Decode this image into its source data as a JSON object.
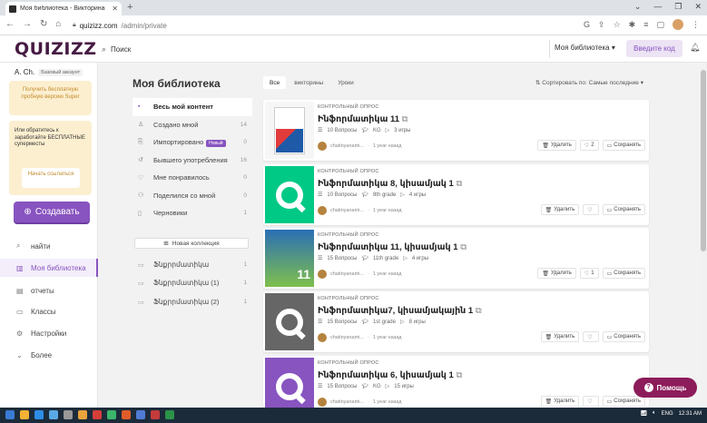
{
  "browser": {
    "tab_title": "Моя библиотека - Викторина",
    "url_host": "quizizz.com",
    "url_path": "/admin/private"
  },
  "header": {
    "logo": "QUIZIZZ",
    "search_placeholder": "Поиск",
    "library_selector": "Моя библиотека",
    "enter_code": "Введите код"
  },
  "sidebar": {
    "user_name": "A. Ch.",
    "account_type": "Базовый аккаунт",
    "promo_text": "Получить бесплатную пробную версию Super",
    "promo2_text": "Или обратитесь к заработайте БЕСПЛАТНЫЕ суперместы",
    "promo2_button": "Начать ссылаться",
    "create_button": "Создавать",
    "items": [
      {
        "label": "найти",
        "icon": "search-icon"
      },
      {
        "label": "Моя библиотека",
        "icon": "library-icon",
        "active": true
      },
      {
        "label": "отчеты",
        "icon": "reports-icon"
      },
      {
        "label": "Классы",
        "icon": "classes-icon"
      },
      {
        "label": "Настройки",
        "icon": "settings-icon"
      },
      {
        "label": "Более",
        "icon": "chevron-down-icon"
      }
    ]
  },
  "main": {
    "title": "Моя библиотека",
    "library_nav": [
      {
        "label": "Весь мой контент",
        "count": ""
      },
      {
        "label": "Создано мной",
        "count": "14"
      },
      {
        "label": "Импортировано",
        "badge": "Новый",
        "count": "0"
      },
      {
        "label": "Бывшего употребления",
        "count": "16"
      },
      {
        "label": "Мне понравилось",
        "count": "0"
      },
      {
        "label": "Поделился со мной",
        "count": "0"
      },
      {
        "label": "Черновики",
        "count": "1"
      }
    ],
    "new_collection": "Новая коллекция",
    "collections": [
      {
        "label": "Ֆնքրրմատիկա",
        "count": "1"
      },
      {
        "label": "Ֆնքրրմատիկա (1)",
        "count": "1"
      },
      {
        "label": "Ֆնքրրմատիկա (2)",
        "count": "1"
      }
    ],
    "filters": [
      "Все",
      "викторины",
      "Уроки"
    ],
    "sort_label": "Сортировать по: Самые последние"
  },
  "cards": [
    {
      "type": "КОНТРОЛЬНЫЙ ОПРОС",
      "name": "Ինֆորմատիկա 11",
      "questions": "10 Вопросы",
      "grade": "KG",
      "plays": "3 игры",
      "author": "chatinyanami...",
      "time": "1 year назад",
      "delete": "Удалить",
      "likes": "2",
      "save": "Сохранять",
      "thumb": "book"
    },
    {
      "type": "КОНТРОЛЬНЫЙ ОПРОС",
      "name": "Ինֆորմատիկա 8, կիսամյակ 1",
      "questions": "10 Вопросы",
      "grade": "8th grade",
      "plays": "4 игры",
      "author": "chatinyanami...",
      "time": "1 year назад",
      "delete": "Удалить",
      "likes": "",
      "save": "Сохранять",
      "thumb": "green"
    },
    {
      "type": "КОНТРОЛЬНЫЙ ОПРОС",
      "name": "Ինֆորմատիկա 11, կիսամյակ 1",
      "questions": "15 Вопросы",
      "grade": "11th grade",
      "plays": "4 игры",
      "author": "chatinyanami...",
      "time": "1 year назад",
      "delete": "Удалить",
      "likes": "1",
      "save": "Сохранять",
      "thumb": "book2"
    },
    {
      "type": "КОНТРОЛЬНЫЙ ОПРОС",
      "name": "Ինֆորմատիկա7, կիսամյակային 1",
      "questions": "15 Вопросы",
      "grade": "1st grade",
      "plays": "8 игры",
      "author": "chatinyanami...",
      "time": "1 year назад",
      "delete": "Удалить",
      "likes": "",
      "save": "Сохранять",
      "thumb": "gray"
    },
    {
      "type": "КОНТРОЛЬНЫЙ ОПРОС",
      "name": "Ինֆորմատիկա 6, կիսամյակ 1",
      "questions": "15 Вопросы",
      "grade": "KG",
      "plays": "15 игры",
      "author": "chatinyanami...",
      "time": "1 year назад",
      "delete": "Удалить",
      "likes": "",
      "save": "Сохранять",
      "thumb": "purple"
    }
  ],
  "help_button": "Помощь",
  "taskbar": {
    "lang": "ENG",
    "time": "12:31 AM"
  },
  "colors": {
    "brand": "#8854c0",
    "logo": "#461a42",
    "green": "#00c985",
    "gray": "#666666",
    "help": "#8d1c5b"
  }
}
